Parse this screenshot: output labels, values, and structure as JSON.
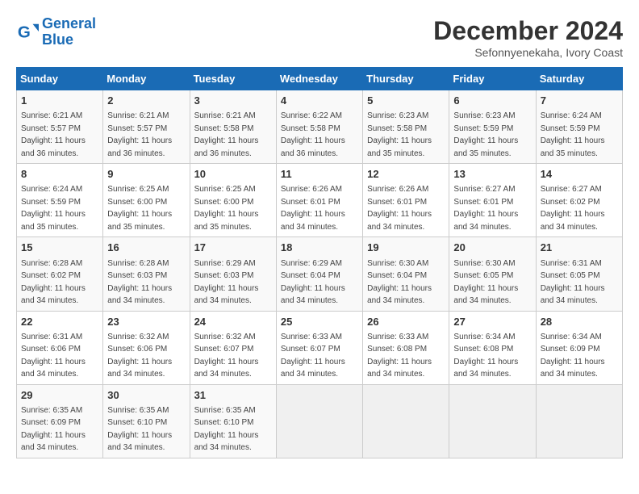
{
  "header": {
    "logo_line1": "General",
    "logo_line2": "Blue",
    "month": "December 2024",
    "location": "Sefonnyenekaha, Ivory Coast"
  },
  "weekdays": [
    "Sunday",
    "Monday",
    "Tuesday",
    "Wednesday",
    "Thursday",
    "Friday",
    "Saturday"
  ],
  "weeks": [
    [
      {
        "day": "1",
        "sunrise": "6:21 AM",
        "sunset": "5:57 PM",
        "daylight": "11 hours and 36 minutes."
      },
      {
        "day": "2",
        "sunrise": "6:21 AM",
        "sunset": "5:57 PM",
        "daylight": "11 hours and 36 minutes."
      },
      {
        "day": "3",
        "sunrise": "6:21 AM",
        "sunset": "5:58 PM",
        "daylight": "11 hours and 36 minutes."
      },
      {
        "day": "4",
        "sunrise": "6:22 AM",
        "sunset": "5:58 PM",
        "daylight": "11 hours and 36 minutes."
      },
      {
        "day": "5",
        "sunrise": "6:23 AM",
        "sunset": "5:58 PM",
        "daylight": "11 hours and 35 minutes."
      },
      {
        "day": "6",
        "sunrise": "6:23 AM",
        "sunset": "5:59 PM",
        "daylight": "11 hours and 35 minutes."
      },
      {
        "day": "7",
        "sunrise": "6:24 AM",
        "sunset": "5:59 PM",
        "daylight": "11 hours and 35 minutes."
      }
    ],
    [
      {
        "day": "8",
        "sunrise": "6:24 AM",
        "sunset": "5:59 PM",
        "daylight": "11 hours and 35 minutes."
      },
      {
        "day": "9",
        "sunrise": "6:25 AM",
        "sunset": "6:00 PM",
        "daylight": "11 hours and 35 minutes."
      },
      {
        "day": "10",
        "sunrise": "6:25 AM",
        "sunset": "6:00 PM",
        "daylight": "11 hours and 35 minutes."
      },
      {
        "day": "11",
        "sunrise": "6:26 AM",
        "sunset": "6:01 PM",
        "daylight": "11 hours and 34 minutes."
      },
      {
        "day": "12",
        "sunrise": "6:26 AM",
        "sunset": "6:01 PM",
        "daylight": "11 hours and 34 minutes."
      },
      {
        "day": "13",
        "sunrise": "6:27 AM",
        "sunset": "6:01 PM",
        "daylight": "11 hours and 34 minutes."
      },
      {
        "day": "14",
        "sunrise": "6:27 AM",
        "sunset": "6:02 PM",
        "daylight": "11 hours and 34 minutes."
      }
    ],
    [
      {
        "day": "15",
        "sunrise": "6:28 AM",
        "sunset": "6:02 PM",
        "daylight": "11 hours and 34 minutes."
      },
      {
        "day": "16",
        "sunrise": "6:28 AM",
        "sunset": "6:03 PM",
        "daylight": "11 hours and 34 minutes."
      },
      {
        "day": "17",
        "sunrise": "6:29 AM",
        "sunset": "6:03 PM",
        "daylight": "11 hours and 34 minutes."
      },
      {
        "day": "18",
        "sunrise": "6:29 AM",
        "sunset": "6:04 PM",
        "daylight": "11 hours and 34 minutes."
      },
      {
        "day": "19",
        "sunrise": "6:30 AM",
        "sunset": "6:04 PM",
        "daylight": "11 hours and 34 minutes."
      },
      {
        "day": "20",
        "sunrise": "6:30 AM",
        "sunset": "6:05 PM",
        "daylight": "11 hours and 34 minutes."
      },
      {
        "day": "21",
        "sunrise": "6:31 AM",
        "sunset": "6:05 PM",
        "daylight": "11 hours and 34 minutes."
      }
    ],
    [
      {
        "day": "22",
        "sunrise": "6:31 AM",
        "sunset": "6:06 PM",
        "daylight": "11 hours and 34 minutes."
      },
      {
        "day": "23",
        "sunrise": "6:32 AM",
        "sunset": "6:06 PM",
        "daylight": "11 hours and 34 minutes."
      },
      {
        "day": "24",
        "sunrise": "6:32 AM",
        "sunset": "6:07 PM",
        "daylight": "11 hours and 34 minutes."
      },
      {
        "day": "25",
        "sunrise": "6:33 AM",
        "sunset": "6:07 PM",
        "daylight": "11 hours and 34 minutes."
      },
      {
        "day": "26",
        "sunrise": "6:33 AM",
        "sunset": "6:08 PM",
        "daylight": "11 hours and 34 minutes."
      },
      {
        "day": "27",
        "sunrise": "6:34 AM",
        "sunset": "6:08 PM",
        "daylight": "11 hours and 34 minutes."
      },
      {
        "day": "28",
        "sunrise": "6:34 AM",
        "sunset": "6:09 PM",
        "daylight": "11 hours and 34 minutes."
      }
    ],
    [
      {
        "day": "29",
        "sunrise": "6:35 AM",
        "sunset": "6:09 PM",
        "daylight": "11 hours and 34 minutes."
      },
      {
        "day": "30",
        "sunrise": "6:35 AM",
        "sunset": "6:10 PM",
        "daylight": "11 hours and 34 minutes."
      },
      {
        "day": "31",
        "sunrise": "6:35 AM",
        "sunset": "6:10 PM",
        "daylight": "11 hours and 34 minutes."
      },
      null,
      null,
      null,
      null
    ]
  ]
}
